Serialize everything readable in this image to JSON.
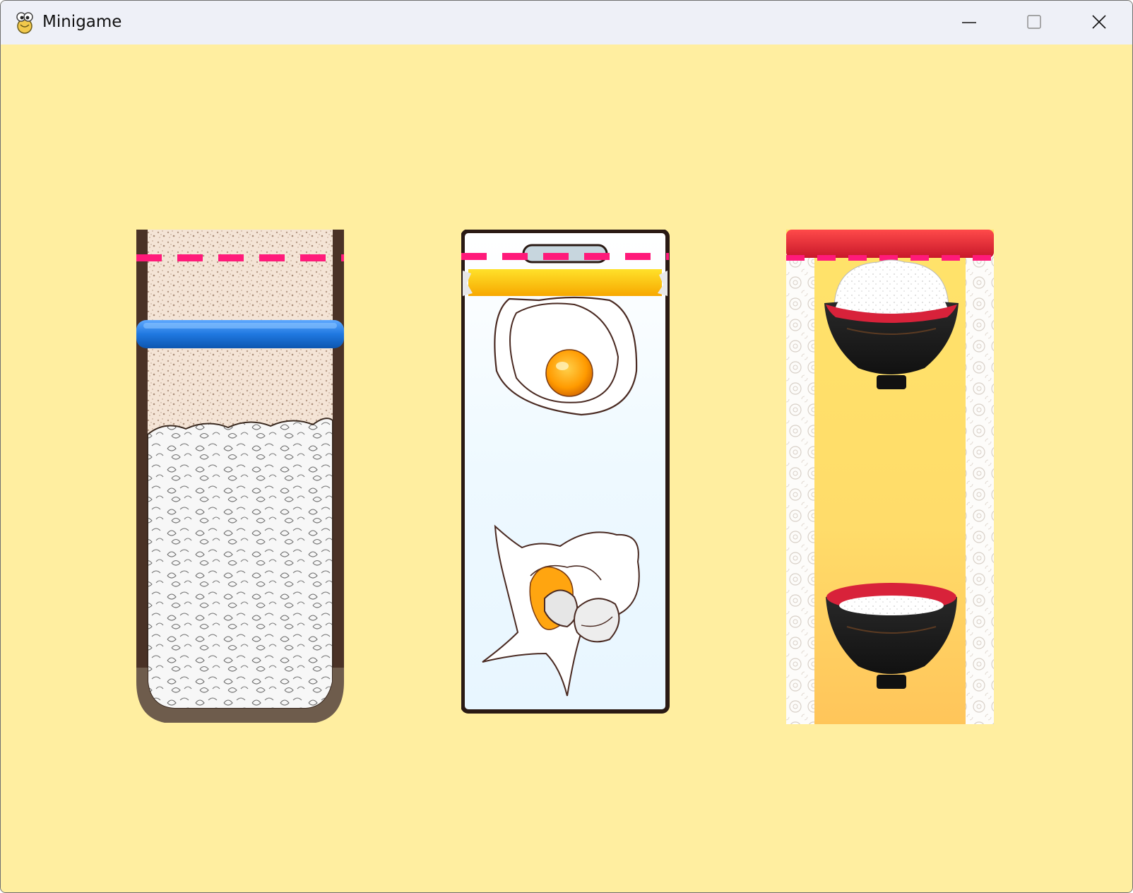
{
  "window": {
    "title": "Minigame",
    "icons": {
      "app": "pygame-snake-icon",
      "minimize": "minimize-icon",
      "maximize": "maximize-icon",
      "close": "close-icon"
    }
  },
  "game": {
    "background_color": "#ffeea0",
    "marker_color": "#ff1a7a",
    "panels": [
      {
        "id": "rice-bag",
        "items": [
          "rice-bag",
          "blue-slider-bar",
          "pink-dashed-line"
        ]
      },
      {
        "id": "egg-pack",
        "items": [
          "egg-carton",
          "fried-egg",
          "cracked-egg",
          "yellow-tape",
          "pink-dashed-line"
        ]
      },
      {
        "id": "rice-bowls",
        "items": [
          "red-ribbon",
          "rice-bowl-full",
          "rice-bowl-flat",
          "lace-border",
          "pink-dashed-line"
        ]
      }
    ]
  }
}
